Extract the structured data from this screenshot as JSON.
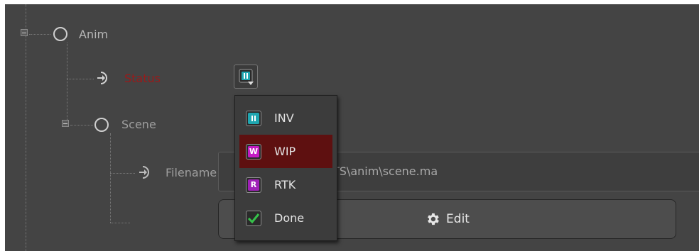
{
  "tree": {
    "anim_label": "Anim",
    "status_label": "Status",
    "scene_label": "Scene",
    "filename_label": "Filename",
    "filename_value": "TS\\anim\\scene.ma"
  },
  "edit_button": {
    "label": "Edit"
  },
  "status_menu": {
    "items": [
      {
        "label": "INV",
        "glyph": "II",
        "color": "#1fa6b0"
      },
      {
        "label": "WIP",
        "glyph": "W",
        "color": "#c41bc4"
      },
      {
        "label": "RTK",
        "glyph": "R",
        "color": "#a020b8"
      },
      {
        "label": "Done",
        "glyph": "check",
        "color": "#36c24a"
      }
    ],
    "selected": "WIP"
  },
  "colors": {
    "panel_bg": "#444444",
    "status_red": "#9a1a1a",
    "menu_highlight": "#5e1010"
  }
}
